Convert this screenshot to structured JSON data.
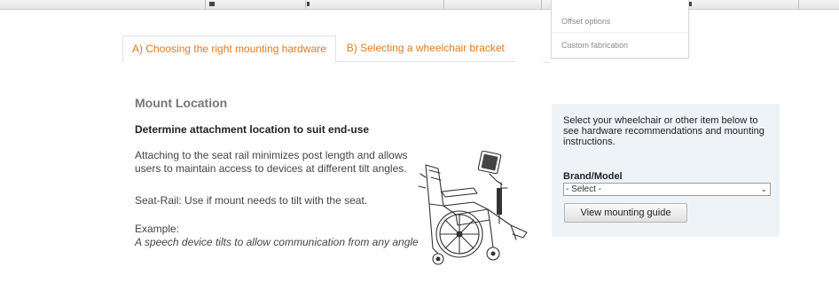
{
  "menu": {
    "items": [
      "Offset options",
      "Custom fabrication"
    ]
  },
  "tabs": [
    {
      "label": "A) Choosing the right mounting hardware",
      "active": true
    },
    {
      "label": "B) Selecting a wheelchair bracket",
      "active": false
    }
  ],
  "content": {
    "section_title": "Mount Location",
    "subhead": "Determine attachment location to suit end-use",
    "para1": "Attaching to the seat rail minimizes post length and allows users to maintain access to devices at different tilt angles.",
    "para2": "Seat-Rail: Use if mount needs to tilt with the seat.",
    "example_label": "Example:",
    "example_text": "A speech device tilts to allow communication from any angle"
  },
  "panel": {
    "intro": "Select your wheelchair or other item below to see hardware recommendations and mounting instructions.",
    "brand_label": "Brand/Model",
    "select_value": "- Select -",
    "button_label": "View mounting guide"
  },
  "colors": {
    "tab_text": "#e07a20",
    "panel_bg": "#eef3f8"
  },
  "icons": {
    "select_arrow": "chevron-down-icon",
    "illustration": "wheelchair-mount-illustration"
  }
}
